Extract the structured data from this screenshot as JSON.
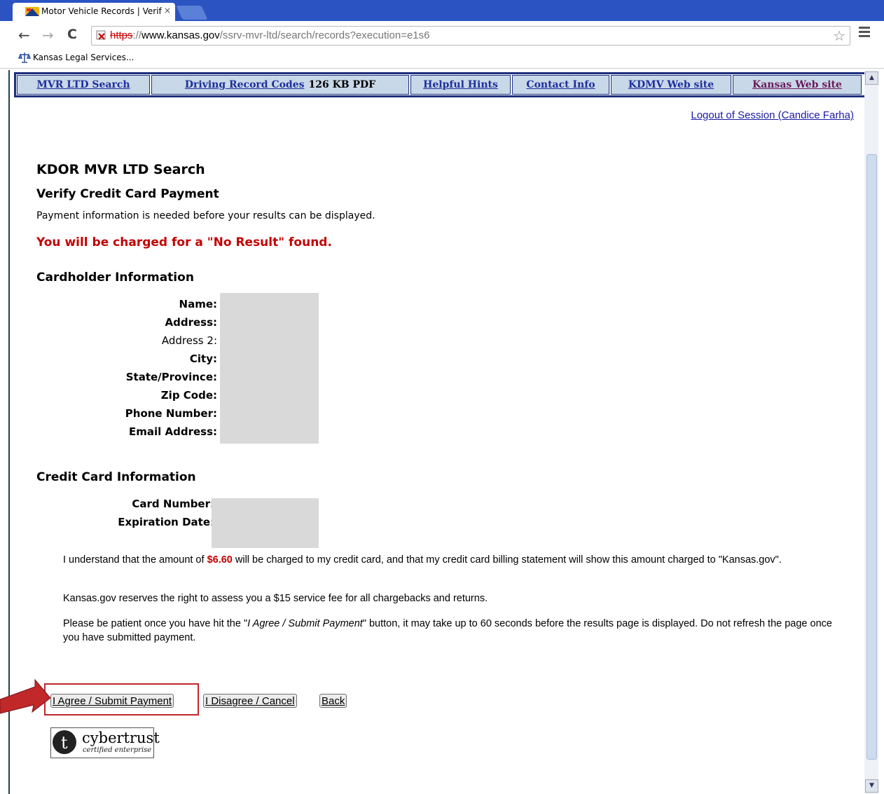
{
  "browser": {
    "tab_title": "Motor Vehicle Records | Verif",
    "tab_close": "×",
    "url_scheme": "https",
    "url_sep": "://",
    "url_host": "www.kansas.gov",
    "url_path": "/ssrv-mvr-ltd/search/records?execution=e1s6",
    "bookmark_label": "Kansas Legal Services...",
    "back": "←",
    "forward": "→",
    "reload": "C",
    "star": "☆"
  },
  "nav": {
    "search": "MVR LTD Search",
    "codes": "Driving Record Codes",
    "codes_size": "126 KB PDF",
    "hints": "Helpful Hints",
    "contact": "Contact Info",
    "kdmv": "KDMV Web site",
    "kansas": "Kansas Web site"
  },
  "logout": "Logout of Session (Candice Farha)",
  "page": {
    "title": "KDOR MVR LTD Search",
    "subtitle": "Verify Credit Card Payment",
    "intro": "Payment information is needed before your results can be displayed.",
    "warning": "You will be charged for a \"No Result\" found."
  },
  "cardholder": {
    "heading": "Cardholder Information",
    "name_label": "Name:",
    "address_label": "Address:",
    "address2_label": "Address 2:",
    "city_label": "City:",
    "state_label": "State/Province:",
    "zip_label": "Zip Code:",
    "phone_label": "Phone Number:",
    "email_label": "Email Address:"
  },
  "card": {
    "heading": "Credit Card Information",
    "number_label": "Card Number:",
    "expiration_label": "Expiration Date:"
  },
  "terms": {
    "p1_a": "I understand that the amount of ",
    "amount": "$6.60",
    "p1_b": " will be charged to my credit card, and that my credit card billing statement will show this amount charged to \"Kansas.gov\".",
    "p2": "Kansas.gov reserves the right to assess you a $15 service fee for all chargebacks and returns.",
    "p3_a": "Please be patient once you have hit the \"",
    "p3_em": "I Agree / Submit Payment",
    "p3_b": "\" button, it may take up to 60 seconds before the results page is displayed. Do not refresh the page once you have submitted payment."
  },
  "buttons": {
    "agree": "I Agree / Submit Payment",
    "disagree": "I Disagree / Cancel",
    "back": "Back"
  },
  "seal": {
    "letter": "t",
    "brand": "cybertrust",
    "sub": "certified enterprise"
  },
  "colors": {
    "warning": "#c40000",
    "nav_bg": "#c9d8e8",
    "nav_border": "#1e2f7d",
    "highlight": "#c0282a"
  }
}
